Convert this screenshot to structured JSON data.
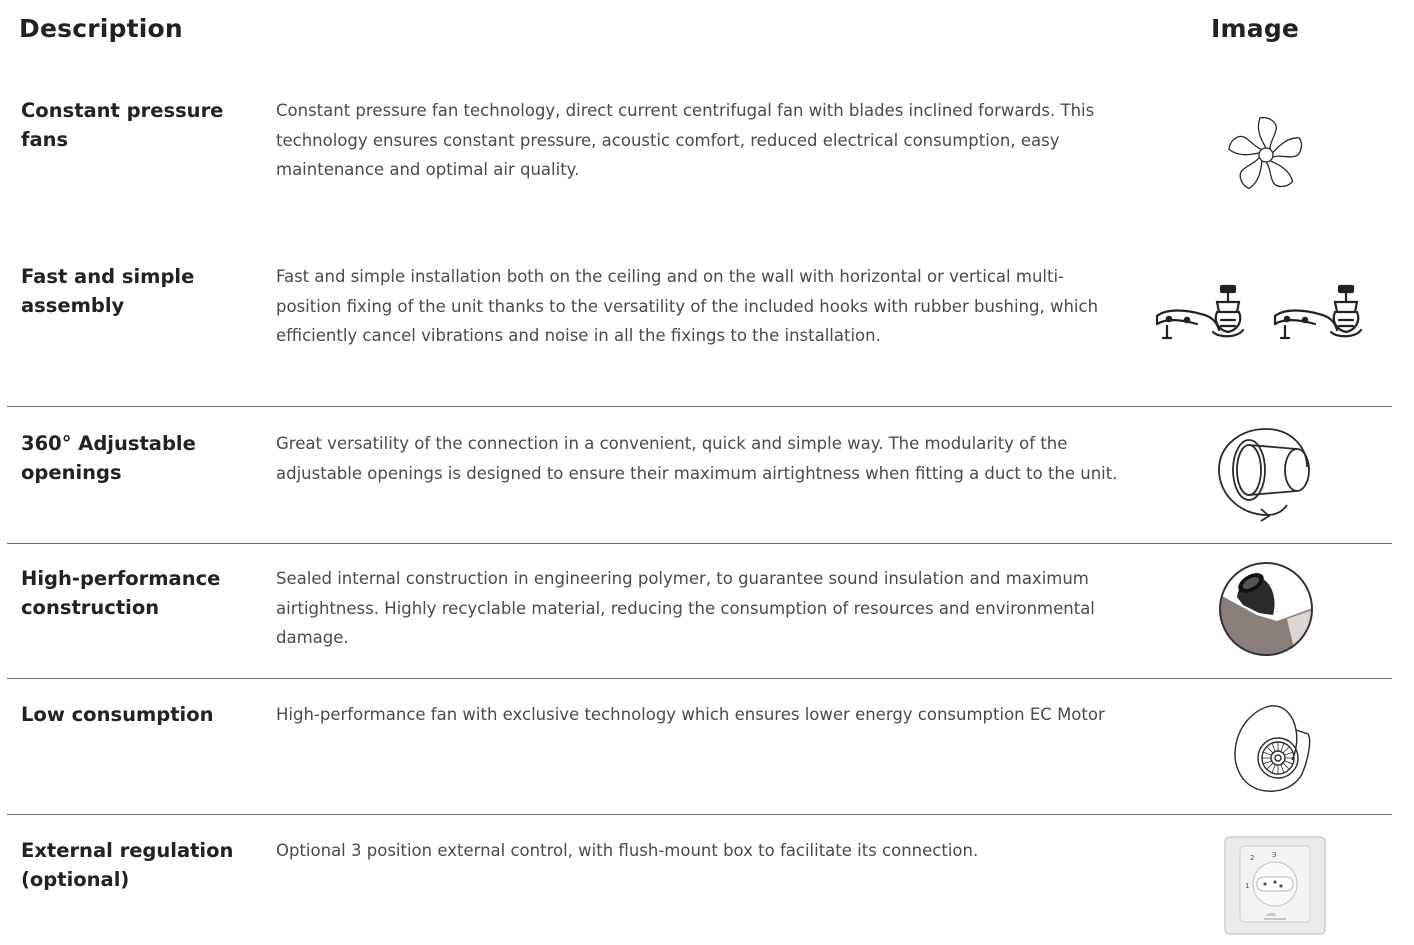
{
  "header": {
    "description": "Description",
    "image": "Image"
  },
  "rows": [
    {
      "title": "Constant pressure fans",
      "description": "Constant pressure fan technology, direct current centrifugal fan with blades inclined forwards. This technology ensures constant pressure, acoustic comfort, reduced electrical consumption, easy maintenance and optimal air quality.",
      "icon": "fan-icon"
    },
    {
      "title": "Fast and simple assembly",
      "description": "Fast and simple installation both on the ceiling and on the wall with horizontal or vertical multi-position fixing of the unit thanks to the versatility of the included hooks with rubber bushing, which efficiently cancel vibrations and noise in all the fixings to the installation.",
      "icon": "mounting-hooks-icon"
    },
    {
      "title": "360° Adjustable openings",
      "description": "Great versatility of the connection in a convenient, quick and simple way. The modularity of the adjustable openings is designed to ensure their maximum airtightness when fitting a duct to the unit.",
      "icon": "rotating-opening-icon"
    },
    {
      "title": "High-performance construction",
      "description": "Sealed internal construction in engineering polymer, to guarantee sound insulation and maximum airtightness. Highly recyclable material, reducing the consumption of resources and environmental damage.",
      "icon": "polymer-construction-photo"
    },
    {
      "title": "Low consumption",
      "description": "High-performance fan with exclusive technology which ensures lower energy consumption EC Motor",
      "icon": "ec-motor-fan-icon"
    },
    {
      "title": "External regulation (optional)",
      "description": "Optional 3 position external control, with flush-mount box to facilitate its connection.",
      "icon": "3-position-switch-photo",
      "switch_labels": [
        "1",
        "2",
        "3"
      ]
    }
  ]
}
